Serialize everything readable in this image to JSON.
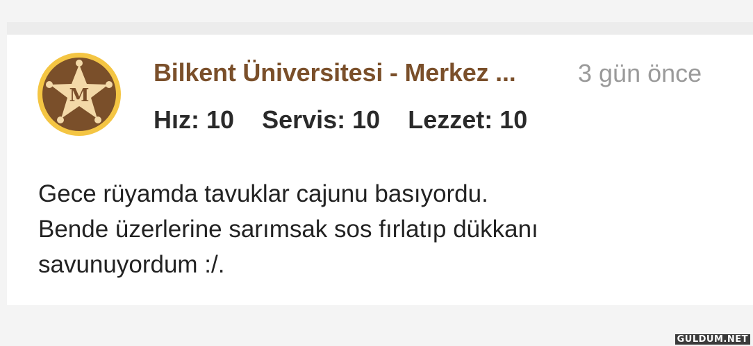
{
  "review": {
    "author": "Bilkent Üniversitesi - Merkez ...",
    "time_ago": "3 gün önce",
    "avatar_icon": "sheriff-star-badge-icon",
    "avatar_letter": "M",
    "ratings": [
      {
        "text": "Hız: 10"
      },
      {
        "text": "Servis: 10"
      },
      {
        "text": "Lezzet: 10"
      }
    ],
    "comment_lines": [
      "Gece rüyamda tavuklar cajunu basıyordu.",
      "Bende üzerlerine sarımsak sos fırlatıp dükkanı",
      "savunuyordum :/."
    ]
  },
  "watermark": "GULDUM.NET",
  "colors": {
    "author": "#7a4f2a",
    "time": "#9a9a9a",
    "badge_ring": "#f4c543",
    "badge_fill": "#7a4f2a",
    "star": "#f3d9a8"
  }
}
